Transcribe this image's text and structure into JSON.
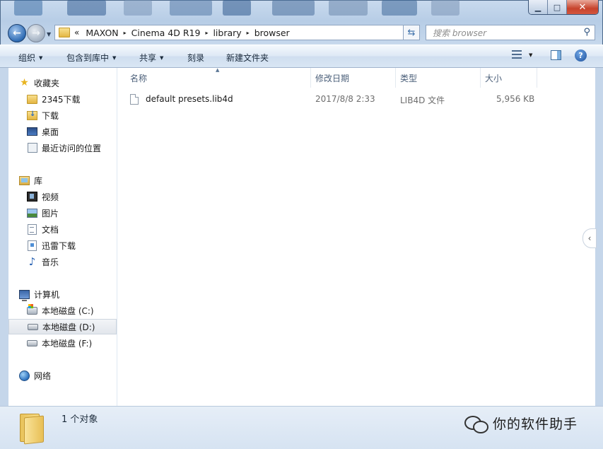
{
  "window": {
    "minimize_glyph": "▁",
    "maximize_glyph": "□",
    "close_glyph": "✕"
  },
  "address_bar": {
    "overflow": "«",
    "path": [
      "MAXON",
      "Cinema 4D R19",
      "library",
      "browser"
    ],
    "separator": "▸"
  },
  "search": {
    "placeholder": "搜索 browser"
  },
  "toolbar": {
    "organize": "组织",
    "include_in_library": "包含到库中",
    "share": "共享",
    "burn": "刻录",
    "new_folder": "新建文件夹"
  },
  "sidebar": {
    "favorites": {
      "label": "收藏夹",
      "items": [
        {
          "label": "2345下载",
          "icon": "folder-icon"
        },
        {
          "label": "下载",
          "icon": "downloads-icon"
        },
        {
          "label": "桌面",
          "icon": "desktop-icon"
        },
        {
          "label": "最近访问的位置",
          "icon": "recent-places-icon"
        }
      ]
    },
    "libraries": {
      "label": "库",
      "items": [
        {
          "label": "视频",
          "icon": "video-icon"
        },
        {
          "label": "图片",
          "icon": "pictures-icon"
        },
        {
          "label": "文档",
          "icon": "documents-icon"
        },
        {
          "label": "迅雷下载",
          "icon": "thunder-download-icon"
        },
        {
          "label": "音乐",
          "icon": "music-icon"
        }
      ]
    },
    "computer": {
      "label": "计算机",
      "items": [
        {
          "label": "本地磁盘 (C:)",
          "icon": "system-drive-icon"
        },
        {
          "label": "本地磁盘 (D:)",
          "icon": "drive-icon",
          "selected": true
        },
        {
          "label": "本地磁盘 (F:)",
          "icon": "drive-icon"
        }
      ]
    },
    "network": {
      "label": "网络"
    }
  },
  "columns": {
    "name": "名称",
    "modified": "修改日期",
    "type": "类型",
    "size": "大小"
  },
  "files": [
    {
      "name": "default presets.lib4d",
      "modified": "2017/8/8 2:33",
      "type": "LIB4D 文件",
      "size": "5,956 KB"
    }
  ],
  "status": {
    "count": "1 个对象",
    "watermark": "你的软件助手"
  }
}
